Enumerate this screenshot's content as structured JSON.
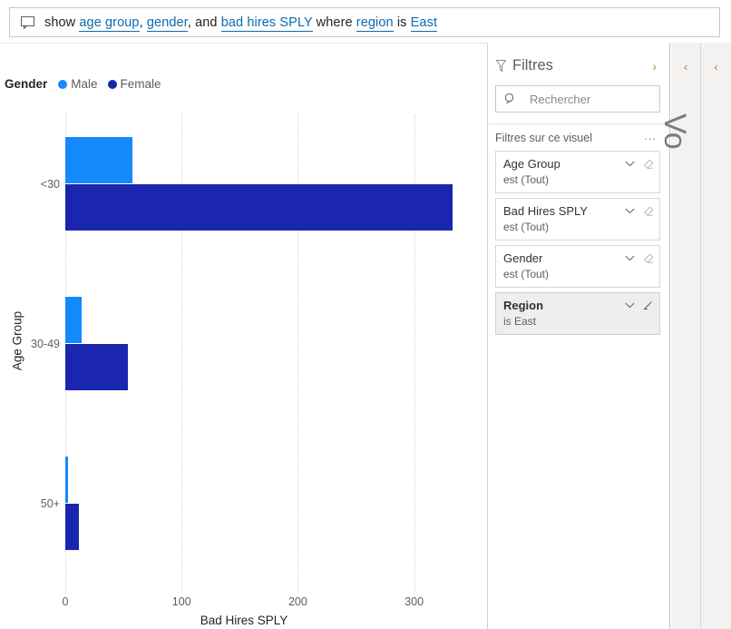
{
  "qna": {
    "icon": "chat-bubble-icon",
    "tokens": [
      {
        "text": "show ",
        "type": "plain"
      },
      {
        "text": "age group",
        "type": "entity"
      },
      {
        "text": ", ",
        "type": "plain"
      },
      {
        "text": "gender",
        "type": "entity"
      },
      {
        "text": ", and ",
        "type": "plain"
      },
      {
        "text": "bad hires SPLY",
        "type": "entity"
      },
      {
        "text": " where ",
        "type": "plain"
      },
      {
        "text": "region",
        "type": "entity"
      },
      {
        "text": " is ",
        "type": "plain"
      },
      {
        "text": "East",
        "type": "entity"
      }
    ],
    "full_text": "show age group, gender, and bad hires SPLY where region is East"
  },
  "chart_data": {
    "type": "bar",
    "orientation": "horizontal",
    "grouping": "grouped",
    "title": "",
    "xlabel": "Bad Hires SPLY",
    "ylabel": "Age Group",
    "categories": [
      "<30",
      "30-49",
      "50+"
    ],
    "series": [
      {
        "name": "Male",
        "color": "#1489FA",
        "values": [
          58,
          14,
          2
        ]
      },
      {
        "name": "Female",
        "color": "#1A26AD",
        "values": [
          333,
          54,
          12
        ]
      }
    ],
    "xticks": [
      0,
      100,
      200,
      300
    ],
    "xlim": [
      0,
      312
    ],
    "grid": true,
    "legend": {
      "title": "Gender",
      "position": "top-left"
    }
  },
  "filter_pane": {
    "title": "Filtres",
    "funnel_icon": "funnel-icon",
    "expand_icon": "chevron-right-icon",
    "search": {
      "placeholder": "Rechercher",
      "value": "",
      "icon": "search-icon"
    },
    "section_label": "Filtres sur ce visuel",
    "more_label": "...",
    "cards": [
      {
        "name": "Age Group",
        "value": "est (Tout)",
        "active": false,
        "chevron_icon": "chevron-down-icon",
        "clear_icon": "eraser-icon"
      },
      {
        "name": "Bad Hires SPLY",
        "value": "est (Tout)",
        "active": false,
        "chevron_icon": "chevron-down-icon",
        "clear_icon": "eraser-icon"
      },
      {
        "name": "Gender",
        "value": "est (Tout)",
        "active": false,
        "chevron_icon": "chevron-down-icon",
        "clear_icon": "eraser-icon"
      },
      {
        "name": "Region",
        "value": "is East",
        "active": true,
        "chevron_icon": "chevron-down-icon",
        "clear_icon": "eraser-icon"
      }
    ]
  },
  "collapsed_panels": [
    {
      "name": "filters-collapsed",
      "chevron": "‹",
      "label": ""
    },
    {
      "name": "visualizations-collapsed",
      "chevron": "‹",
      "label": "Vo"
    }
  ],
  "colors": {
    "male": "#1489FA",
    "female": "#1A26AD",
    "accent_link": "#0d6ab0",
    "chevron_accent": "#c77b30",
    "panel_bg": "#f3f2f1"
  }
}
